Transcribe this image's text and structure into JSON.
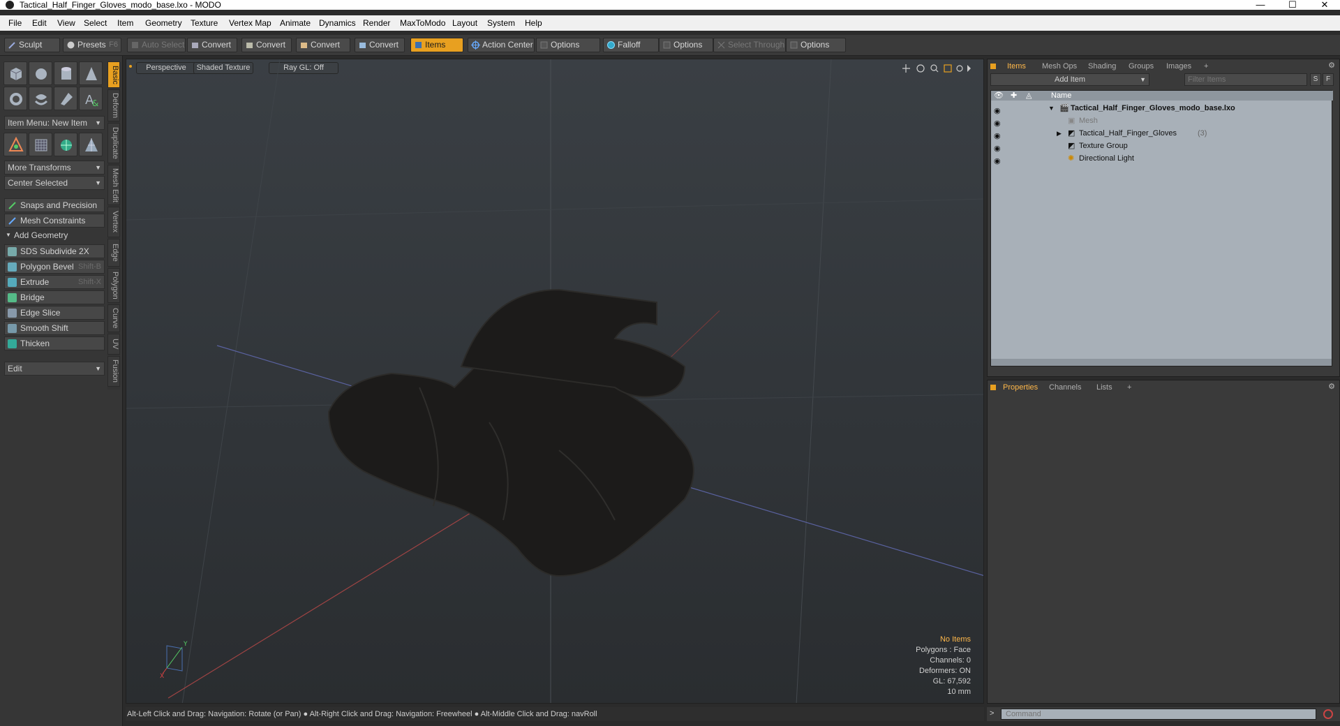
{
  "window": {
    "title": "Tactical_Half_Finger_Gloves_modo_base.lxo - MODO",
    "minimize": "—",
    "maximize": "☐",
    "close": "✕"
  },
  "menu": [
    "File",
    "Edit",
    "View",
    "Select",
    "Item",
    "Geometry",
    "Texture",
    "Vertex Map",
    "Animate",
    "Dynamics",
    "Render",
    "MaxToModo",
    "Layout",
    "System",
    "Help"
  ],
  "toolbar": {
    "sculpt": "Sculpt",
    "presets": "Presets",
    "presets_shortcut": "F6",
    "auto_select": "Auto Select",
    "convert1": "Convert",
    "convert2": "Convert",
    "convert3": "Convert",
    "convert4": "Convert",
    "items": "Items",
    "action_center": "Action Center",
    "options1": "Options",
    "falloff": "Falloff",
    "options2": "Options",
    "select_through": "Select Through",
    "options3": "Options"
  },
  "left": {
    "item_menu": "Item Menu: New Item",
    "more_transforms": "More Transforms",
    "center_selected": "Center Selected",
    "snaps": "Snaps and Precision",
    "mesh_constraints": "Mesh Constraints",
    "add_geometry": "Add Geometry",
    "tools": [
      {
        "label": "SDS Subdivide 2X",
        "shortcut": ""
      },
      {
        "label": "Polygon Bevel",
        "shortcut": "Shift-B"
      },
      {
        "label": "Extrude",
        "shortcut": "Shift-X"
      },
      {
        "label": "Bridge",
        "shortcut": ""
      },
      {
        "label": "Edge Slice",
        "shortcut": ""
      },
      {
        "label": "Smooth Shift",
        "shortcut": ""
      },
      {
        "label": "Thicken",
        "shortcut": ""
      }
    ],
    "edit": "Edit",
    "vtabs": [
      "Basic",
      "Deform",
      "Duplicate",
      "Mesh Edit",
      "Vertex",
      "Edge",
      "Polygon",
      "Curve",
      "UV",
      "Fusion"
    ]
  },
  "viewport": {
    "perspective": "Perspective",
    "shaded_texture": "Shaded Texture",
    "ray_gl": "Ray GL: Off",
    "stats": {
      "no_items": "No Items",
      "polygons": "Polygons : Face",
      "channels": "Channels: 0",
      "deformers": "Deformers: ON",
      "gl": "GL: 67,592",
      "scale": "10 mm"
    }
  },
  "status": "Alt-Left Click and Drag: Navigation: Rotate (or Pan) ● Alt-Right Click and Drag: Navigation: Freewheel ● Alt-Middle Click and Drag: navRoll",
  "items_panel": {
    "tabs": [
      "Items",
      "Mesh Ops",
      "Shading",
      "Groups",
      "Images",
      "+"
    ],
    "add_item": "Add Item",
    "filter_placeholder": "Filter Items",
    "filter_s": "S",
    "filter_f": "F",
    "col_name": "Name",
    "rows": [
      {
        "label": "Tactical_Half_Finger_Gloves_modo_base.lxo",
        "count": ""
      },
      {
        "label": "Mesh",
        "count": ""
      },
      {
        "label": "Tactical_Half_Finger_Gloves",
        "count": "(3)"
      },
      {
        "label": "Texture Group",
        "count": ""
      },
      {
        "label": "Directional Light",
        "count": ""
      }
    ]
  },
  "props_panel": {
    "tabs": [
      "Properties",
      "Channels",
      "Lists",
      "+"
    ]
  },
  "command": {
    "placeholder": "Command",
    "prompt": ">"
  },
  "colors": {
    "accent": "#e8a020",
    "highlight_text": "#ffb84a"
  }
}
